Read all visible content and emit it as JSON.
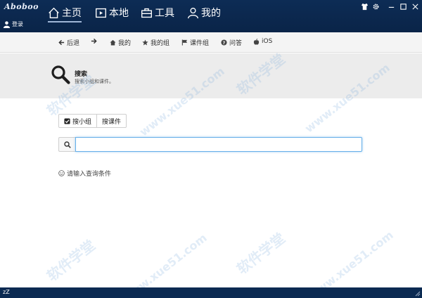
{
  "app": {
    "logo_text": "Aboboo",
    "nav_tabs": [
      {
        "label": "主页",
        "icon": "home-icon",
        "active": true
      },
      {
        "label": "本地",
        "icon": "local-video-icon"
      },
      {
        "label": "工具",
        "icon": "toolbox-icon"
      },
      {
        "label": "我的",
        "icon": "user-icon"
      }
    ],
    "login_label": "登录",
    "window_controls": [
      "shirt-skin-icon",
      "gear-icon",
      "minimize-icon",
      "maximize-icon",
      "close-icon"
    ]
  },
  "subnav": {
    "items": [
      {
        "label": "后退",
        "icon": "arrow-left-icon"
      },
      {
        "label": "",
        "icon": "arrow-right-icon"
      },
      {
        "label": "我的",
        "icon": "home-icon"
      },
      {
        "label": "我的组",
        "icon": "star-icon"
      },
      {
        "label": "课件组",
        "icon": "flag-icon"
      },
      {
        "label": "问答",
        "icon": "question-circle-icon"
      },
      {
        "label": "iOS",
        "icon": "apple-icon"
      }
    ]
  },
  "header": {
    "title": "搜索",
    "subtitle": "搜索小组和课件。"
  },
  "search": {
    "toggles": [
      {
        "label": "搜小组",
        "checked": true
      },
      {
        "label": "搜课件",
        "checked": false
      }
    ],
    "input_value": "",
    "hint": "请输入查询条件"
  },
  "watermarks": [
    "软件学堂",
    "www.xue51.com"
  ],
  "statusbar": {
    "sleep_label": "zZ"
  },
  "colors": {
    "titlebar": "#0d2c55",
    "accent": "#66afe9",
    "band": "#ececec"
  }
}
